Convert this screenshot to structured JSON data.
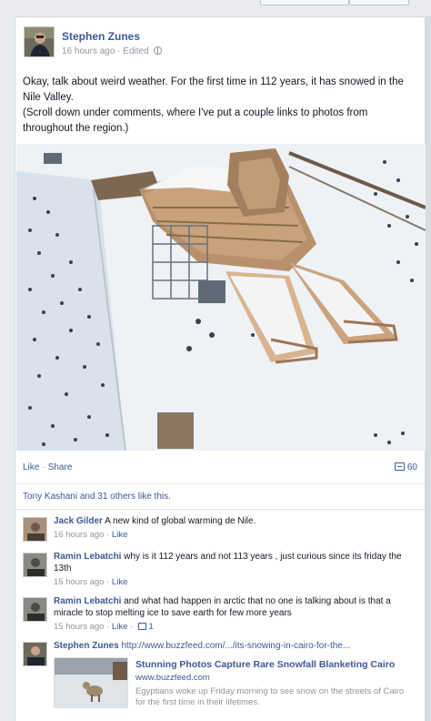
{
  "post": {
    "author": "Stephen Zunes",
    "time": "16 hours ago",
    "edited": "Edited",
    "text_line1": "Okay, talk about weird weather. For the first time in 112 years, it has snowed in the Nile Valley.",
    "text_line2": "(Scroll down under comments, where I've put a couple links to photos from throughout the region.)",
    "like_label": "Like",
    "share_label": "Share",
    "comment_count": "60",
    "likes_summary": "Tony Kashani and 31 others like this."
  },
  "comments": [
    {
      "author": "Jack Gilder",
      "text": "A new kind of global warming de Nile.",
      "time": "16 hours ago",
      "like_label": "Like"
    },
    {
      "author": "Ramin Lebatchi",
      "text": "why is it 112 years and not 113 years , just curious since its friday the 13th",
      "time": "15 hours ago",
      "like_label": "Like"
    },
    {
      "author": "Ramin Lebatchi",
      "text": "and what had happen in arctic that no one is talking about is that a miracle to stop melting ice to save earth for few more years",
      "time": "15 hours ago",
      "like_label": "Like",
      "likes": "1"
    },
    {
      "author": "Stephen Zunes",
      "text": "http://www.buzzfeed.com/.../its-snowing-in-cairo-for-the...",
      "link_title": "Stunning Photos Capture Rare Snowfall Blanketing Cairo",
      "link_domain": "www.buzzfeed.com",
      "link_desc": "Egyptians woke up Friday morning to see snow on the streets of Cairo for the first time in their lifetimes."
    }
  ],
  "separator": "·",
  "colors": {
    "link": "#3b5998",
    "meta": "#90949c",
    "text": "#141823"
  }
}
